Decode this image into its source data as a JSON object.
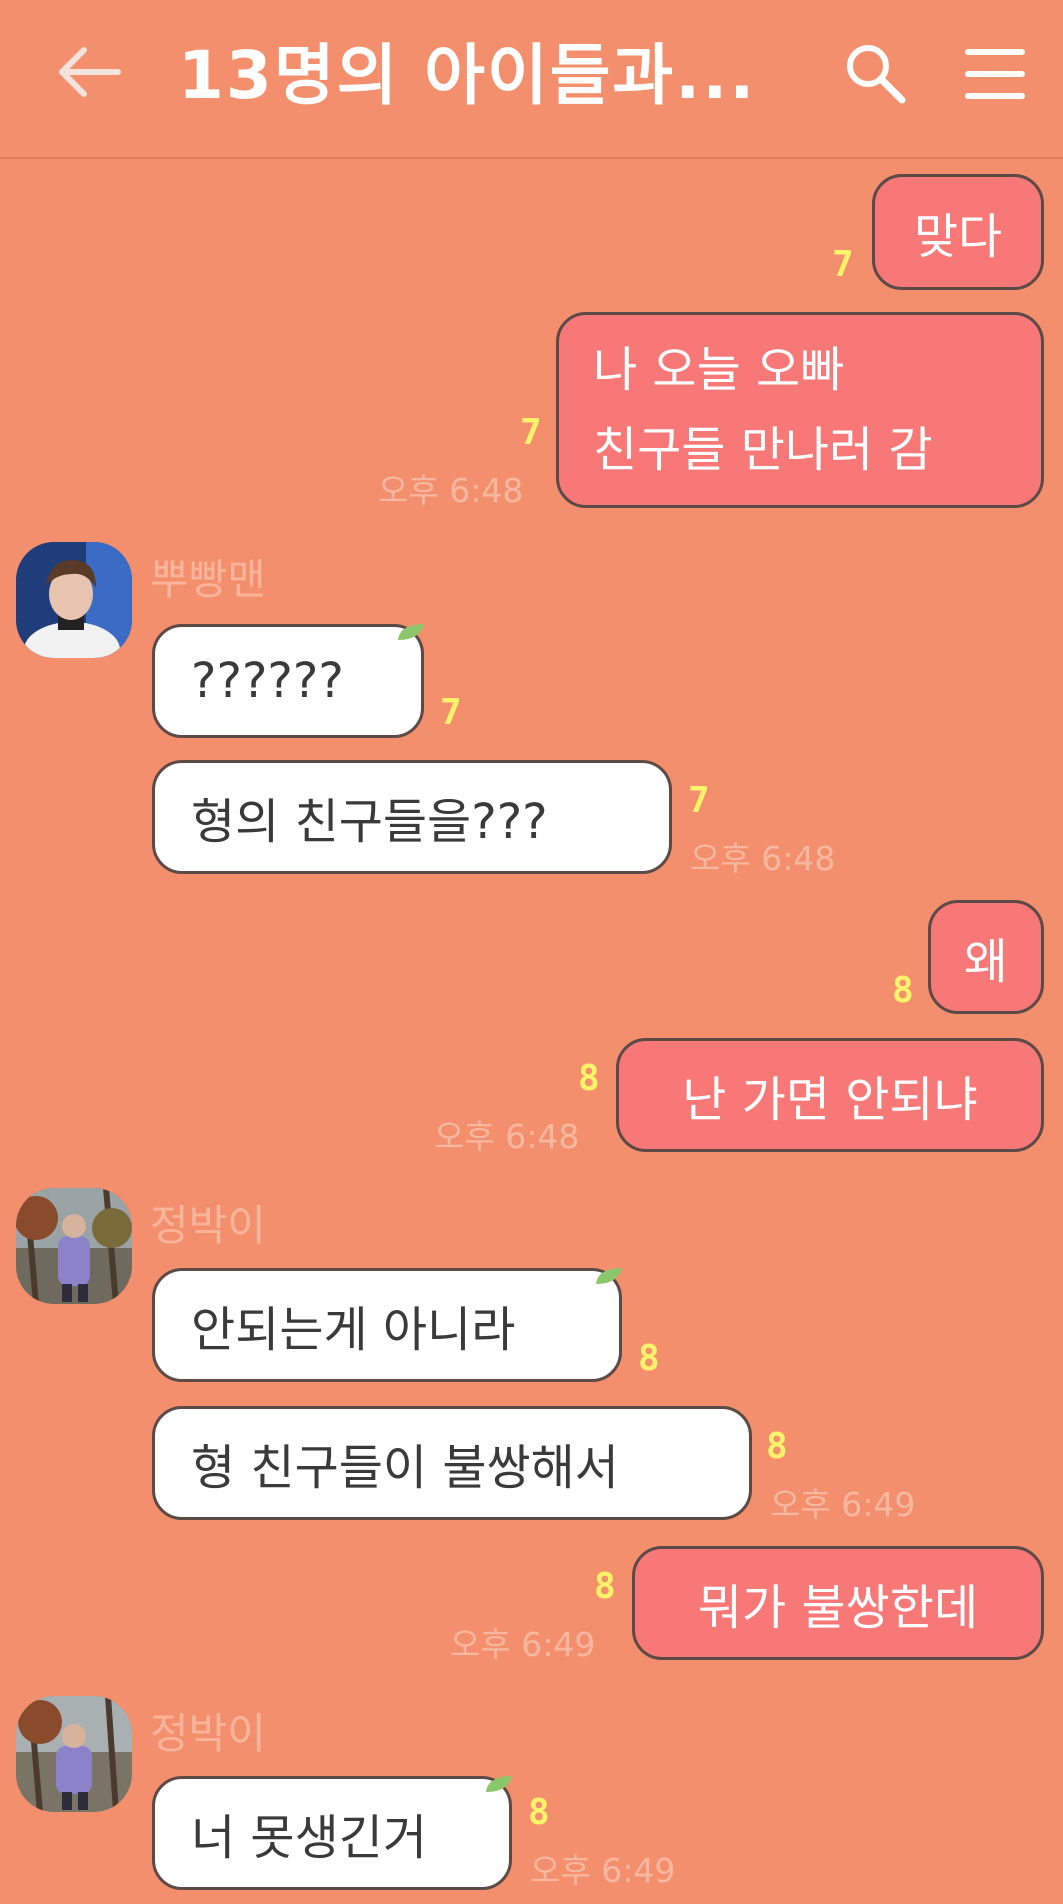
{
  "header": {
    "title": "13명의 아이들과...",
    "back_icon": "arrow-left-icon",
    "search_icon": "search-icon",
    "menu_icon": "hamburger-menu-icon"
  },
  "colors": {
    "background": "#f48f6d",
    "my_bubble": "#f87878",
    "other_bubble": "#ffffff",
    "read_count": "#fff36a",
    "time": "#f7b8a1",
    "sender_name": "#f8b59c"
  },
  "messages": [
    {
      "side": "me",
      "text": "맞다",
      "read": "7"
    },
    {
      "side": "me",
      "lines": [
        "나 오늘 오빠",
        "친구들 만나러 감"
      ],
      "read": "7",
      "time": "오후 6:48"
    },
    {
      "side": "other",
      "sender": "뿌빵맨",
      "text": "??????",
      "read": "7"
    },
    {
      "side": "other",
      "text": "형의 친구들을???",
      "read": "7",
      "time": "오후 6:48"
    },
    {
      "side": "me",
      "text": "왜",
      "read": "8"
    },
    {
      "side": "me",
      "text": "난 가면 안되냐",
      "read": "8",
      "time": "오후 6:48"
    },
    {
      "side": "other",
      "sender": "정박이",
      "text": "안되는게 아니라",
      "read": "8"
    },
    {
      "side": "other",
      "text": "형 친구들이 불쌍해서",
      "read": "8",
      "time": "오후 6:49"
    },
    {
      "side": "me",
      "text": "뭐가 불쌍한데",
      "read": "8",
      "time": "오후 6:49"
    },
    {
      "side": "other",
      "sender": "정박이",
      "text": "너 못생긴거",
      "read": "8",
      "time": "오후 6:49"
    }
  ]
}
